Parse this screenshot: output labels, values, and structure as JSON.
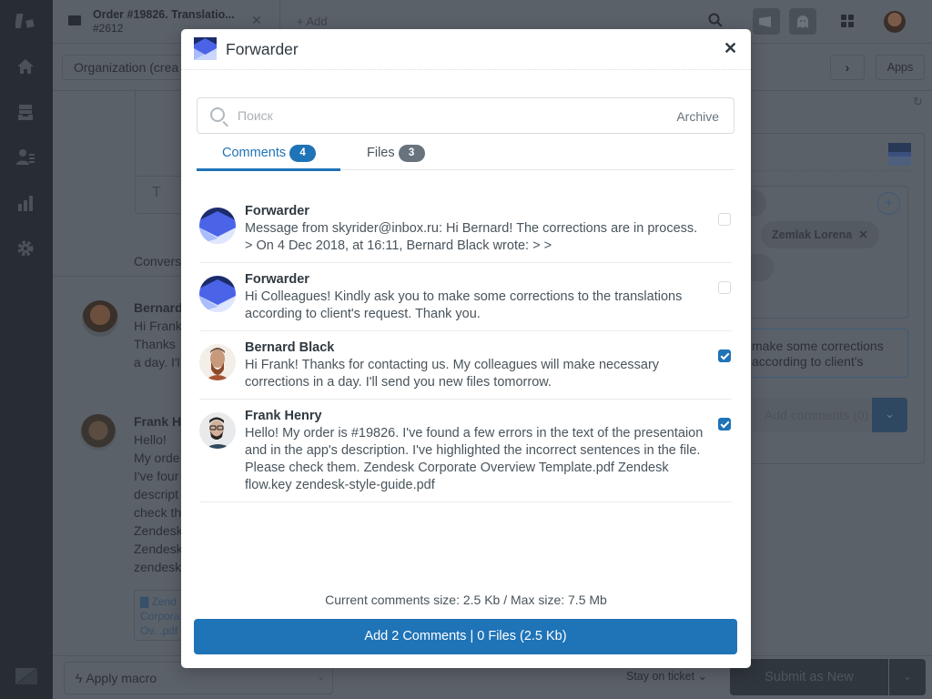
{
  "app": {
    "sidebar": {
      "icons": [
        "zendesk-logo-icon",
        "home-icon",
        "views-icon",
        "customers-icon",
        "reporting-icon",
        "admin-gear-icon",
        "zendesk-z-icon"
      ]
    },
    "topbar": {
      "ticket_tab_title": "Order #19826. Translatio...",
      "ticket_tab_number": "#2612",
      "add_label": "+ Add"
    },
    "org_field": "Organization (crea",
    "apps_label": "Apps",
    "editor_placeholder": "T",
    "conversation_label": "Convers",
    "background_messages": [
      {
        "author": "Bernard",
        "lines": [
          "Hi Frank",
          "Thanks",
          "a day. I'l"
        ]
      },
      {
        "author": "Frank H",
        "lines": [
          "Hello!",
          "My orde",
          "I've four",
          "descript",
          "check th",
          "Zendesk",
          "Zendesk",
          "zendesk"
        ]
      }
    ],
    "attachment": {
      "lines": [
        "Zend",
        "Corpora",
        "Ov...pdf"
      ]
    },
    "right_panel": {
      "chips": [
        "Zemlak Lorena"
      ],
      "quote_lines": [
        "make some corrections",
        "according to client's"
      ],
      "add_comments_label": "Add comments (0)"
    },
    "bottom_bar": {
      "macro_label": "Apply macro",
      "stay_label": "Stay on ticket",
      "submit_label": "Submit as New"
    }
  },
  "modal": {
    "title": "Forwarder",
    "search": {
      "placeholder": "Поиск",
      "value": "",
      "archive_label": "Archive"
    },
    "tabs": [
      {
        "label": "Comments",
        "count": "4",
        "active": true
      },
      {
        "label": "Files",
        "count": "3",
        "active": false
      }
    ],
    "comments": [
      {
        "author": "Forwarder",
        "avatar": "forwarder-logo",
        "text": "Message from skyrider@inbox.ru: Hi Bernard! The corrections are in process. > On 4 Dec 2018, at 16:11, Bernard Black wrote: > >",
        "checked": false
      },
      {
        "author": "Forwarder",
        "avatar": "forwarder-logo",
        "text": "Hi Colleagues! Kindly ask you to make some corrections to the translations according to client's request. Thank you.",
        "checked": false
      },
      {
        "author": "Bernard Black",
        "avatar": "bernard-photo",
        "text": "Hi Frank! Thanks for contacting us. My colleagues will make necessary corrections in a day. I'll send you new files tomorrow.",
        "checked": true
      },
      {
        "author": "Frank Henry",
        "avatar": "frank-photo",
        "text": "Hello! My order is #19826. I've found a few errors in the text of the presentaion and in the app's description. I've highlighted the incorrect sentences in the file. Please check them. Zendesk Corporate Overview Template.pdf Zendesk flow.key zendesk-style-guide.pdf",
        "checked": true
      }
    ],
    "size_info": "Current comments size: 2.5 Kb / Max size: 7.5 Mb",
    "add_button_label": "Add 2 Comments | 0 Files (2.5 Kb)"
  },
  "colors": {
    "accent": "#1f73b7",
    "overlay_bg": "#5b6169",
    "sidebar_bg": "#272d33",
    "files_badge": "#68737d"
  }
}
